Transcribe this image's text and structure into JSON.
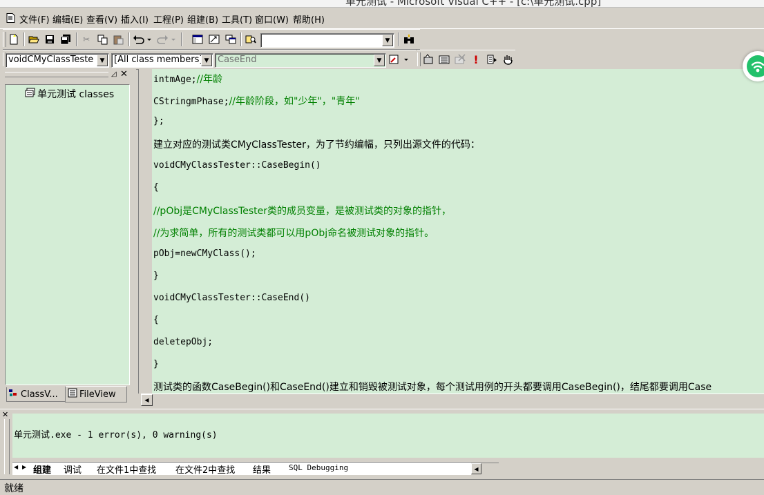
{
  "window": {
    "title": "单元测试 - Microsoft Visual C++ - [c:\\单元测试.cpp]"
  },
  "menu": [
    "文件(F)",
    "编辑(E)",
    "查看(V)",
    "插入(I)",
    "工程(P)",
    "组建(B)",
    "工具(T)",
    "窗口(W)",
    "帮助(H)"
  ],
  "toolbar_std": {
    "buttons": [
      "new-text-file",
      "open",
      "save",
      "save-all",
      "cut",
      "copy",
      "paste",
      "undo",
      "redo",
      "workspace",
      "output",
      "window-list",
      "find-in-files",
      "search"
    ],
    "find_value": ""
  },
  "toolbar_wizard": {
    "class_combo": "voidCMyClassTeste",
    "filter_combo": "[All class members]",
    "member_combo": "CaseEnd"
  },
  "toolbar_build": {
    "buttons": [
      "compile",
      "build",
      "stop-build",
      "execute",
      "go",
      "insert-remove-breakpoint"
    ]
  },
  "workspace": {
    "tree_root": "单元测试 classes",
    "tabs": [
      "ClassV...",
      "FileView"
    ],
    "active_tab": "FileView"
  },
  "editor": {
    "lines": [
      {
        "code": "intmAge;",
        "comment": "//年龄"
      },
      {
        "code": "CStringmPhase;",
        "comment": "//年龄阶段，如\"少年\"，\"青年\""
      },
      {
        "code": "};",
        "comment": ""
      },
      {
        "code": "建立对应的测试类CMyClassTester，为了节约编幅，只列出源文件的代码：",
        "comment": ""
      },
      {
        "code": "voidCMyClassTester::CaseBegin()",
        "comment": ""
      },
      {
        "code": "{",
        "comment": ""
      },
      {
        "code": "",
        "comment": "//pObj是CMyClassTester类的成员变量，是被测试类的对象的指针，"
      },
      {
        "code": "",
        "comment": "//为求简单，所有的测试类都可以用pObj命名被测试对象的指针。"
      },
      {
        "code": "pObj=newCMyClass();",
        "comment": ""
      },
      {
        "code": "}",
        "comment": ""
      },
      {
        "code": "voidCMyClassTester::CaseEnd()",
        "comment": ""
      },
      {
        "code": "{",
        "comment": ""
      },
      {
        "code": "deletepObj;",
        "comment": ""
      },
      {
        "code": "}",
        "comment": ""
      },
      {
        "code": "测试类的函数CaseBegin()和CaseEnd()建立和销毁被测试对象，每个测试用例的开头都要调用CaseBegin()，结尾都要调用Case",
        "comment": ""
      }
    ]
  },
  "output": {
    "message": "单元测试.exe - 1 error(s), 0 warning(s)",
    "tabs": [
      "组建",
      "调试",
      "在文件1中查找",
      "在文件2中查找",
      "结果",
      "SQL Debugging"
    ],
    "active_tab": "组建"
  },
  "status": {
    "text": "就绪"
  },
  "colors": {
    "editor_bg": "#d4edd6",
    "comment": "#008000",
    "chrome": "#d4d0c8",
    "badge": "#22c16b"
  }
}
